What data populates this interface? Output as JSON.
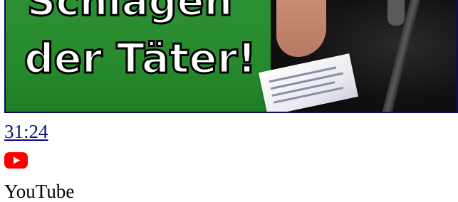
{
  "video": {
    "thumbnail_text_top": "Schlagen",
    "thumbnail_text_main": "der Täter!",
    "duration": "31:24"
  },
  "source": {
    "icon": "youtube-logo-icon",
    "label": "YouTube",
    "brand_color": "#ff0000"
  },
  "colors": {
    "thumbnail_green": "#2d8f33",
    "link": "#0b0b8e"
  }
}
